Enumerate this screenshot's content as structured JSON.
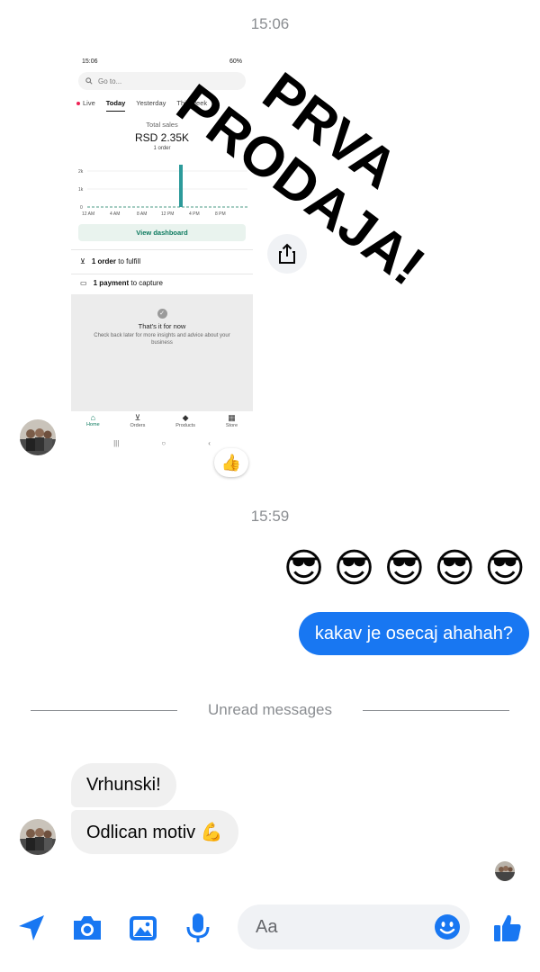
{
  "timestamps": {
    "first": "15:06",
    "second": "15:59"
  },
  "shared_image": {
    "status_time": "15:06",
    "status_right": "60%",
    "search_placeholder": "Go to...",
    "tabs": [
      "Live",
      "Today",
      "Yesterday",
      "This week"
    ],
    "active_tab": "Today",
    "total_sales_label": "Total sales",
    "total_sales_value": "RSD 2.35K",
    "orders_count": "1 order",
    "chart_y_ticks": [
      "2k",
      "1k",
      "0"
    ],
    "chart_x_ticks": [
      "12 AM",
      "4 AM",
      "8 AM",
      "12 PM",
      "4 PM",
      "8 PM"
    ],
    "view_dashboard": "View dashboard",
    "fulfill_bold": "1 order",
    "fulfill_rest": "to fulfill",
    "capture_bold": "1 payment",
    "capture_rest": "to capture",
    "empty_title": "That's it for now",
    "empty_text": "Check back later for more insights and advice about your business",
    "bottom_nav": [
      "Home",
      "Orders",
      "Products",
      "Store"
    ],
    "overlay_line1": "PRVA",
    "overlay_line2": "PRODAJA!"
  },
  "reaction": "👍",
  "sent_emojis": [
    "😎",
    "😎",
    "😎",
    "😎",
    "😎"
  ],
  "sent_message": "kakav je osecaj ahahah?",
  "unread_label": "Unread messages",
  "received": [
    "Vrhunski!",
    "Odlican motiv 💪"
  ],
  "composer": {
    "placeholder": "Aa",
    "icons": [
      "location-arrow-icon",
      "camera-icon",
      "gallery-icon",
      "microphone-icon",
      "emoji-icon",
      "thumbs-up-icon"
    ],
    "accent": "#1877f2"
  }
}
